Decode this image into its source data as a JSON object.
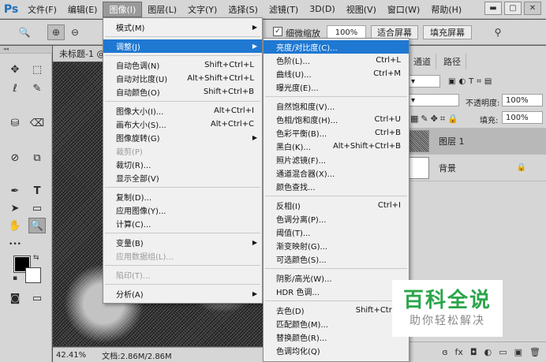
{
  "menubar": {
    "logo": "Ps",
    "items": [
      "文件(F)",
      "编辑(E)",
      "图像(I)",
      "图层(L)",
      "文字(Y)",
      "选择(S)",
      "滤镜(T)",
      "3D(D)",
      "视图(V)",
      "窗口(W)",
      "帮助(H)"
    ],
    "window_controls": [
      "▬",
      "▢",
      "✕"
    ]
  },
  "options": {
    "tool_icon": "🔍",
    "zoom_in": "⊕",
    "zoom_out": "⊖",
    "scrubby_label": "细微缩放",
    "zoom_value": "100%",
    "fit_screen": "适合屏幕",
    "fill_screen": "填充屏幕",
    "search_icon": "⚲"
  },
  "tools": {
    "grip": "◂◂",
    "icons": [
      "✥",
      "⬚",
      "ℓ",
      "✎",
      "⛁",
      "⌫",
      "⊘",
      "⧉",
      "✒",
      "T",
      "➤",
      "▭",
      "✋",
      "🔍",
      "•••"
    ],
    "fg_bg_swap": "⇆",
    "default_colors": "▪",
    "quick_mask": "◙",
    "screen_mode": "▭"
  },
  "document": {
    "tab_title": "未标题-1 @",
    "zoom": "42.41%",
    "doc_info": "文档:2.86M/2.86M"
  },
  "panels": {
    "tabs": [
      "通道",
      "路径"
    ],
    "opacity_label": "不透明度:",
    "opacity_value": "100%",
    "fill_label": "填充:",
    "fill_value": "100%",
    "layers": [
      {
        "name": "图层 1",
        "selected": true
      },
      {
        "name": "背景",
        "selected": false,
        "lock": "🔒"
      }
    ],
    "footer_icons": [
      "ɞ",
      "fx",
      "◘",
      "◐",
      "▭",
      "▣",
      "🗑"
    ]
  },
  "image_menu": {
    "items": [
      {
        "label": "模式(M)",
        "shortcut": "",
        "arrow": true,
        "disabled": false,
        "highlight": false,
        "sep_after": true
      },
      {
        "label": "调整(J)",
        "shortcut": "",
        "arrow": true,
        "disabled": false,
        "highlight": true,
        "sep_after": true
      },
      {
        "label": "自动色调(N)",
        "shortcut": "Shift+Ctrl+L",
        "arrow": false,
        "disabled": false,
        "highlight": false,
        "sep_after": false
      },
      {
        "label": "自动对比度(U)",
        "shortcut": "Alt+Shift+Ctrl+L",
        "arrow": false,
        "disabled": false,
        "highlight": false,
        "sep_after": false
      },
      {
        "label": "自动颜色(O)",
        "shortcut": "Shift+Ctrl+B",
        "arrow": false,
        "disabled": false,
        "highlight": false,
        "sep_after": true
      },
      {
        "label": "图像大小(I)...",
        "shortcut": "Alt+Ctrl+I",
        "arrow": false,
        "disabled": false,
        "highlight": false,
        "sep_after": false
      },
      {
        "label": "画布大小(S)...",
        "shortcut": "Alt+Ctrl+C",
        "arrow": false,
        "disabled": false,
        "highlight": false,
        "sep_after": false
      },
      {
        "label": "图像旋转(G)",
        "shortcut": "",
        "arrow": true,
        "disabled": false,
        "highlight": false,
        "sep_after": false
      },
      {
        "label": "裁剪(P)",
        "shortcut": "",
        "arrow": false,
        "disabled": true,
        "highlight": false,
        "sep_after": false
      },
      {
        "label": "裁切(R)...",
        "shortcut": "",
        "arrow": false,
        "disabled": false,
        "highlight": false,
        "sep_after": false
      },
      {
        "label": "显示全部(V)",
        "shortcut": "",
        "arrow": false,
        "disabled": false,
        "highlight": false,
        "sep_after": true
      },
      {
        "label": "复制(D)...",
        "shortcut": "",
        "arrow": false,
        "disabled": false,
        "highlight": false,
        "sep_after": false
      },
      {
        "label": "应用图像(Y)...",
        "shortcut": "",
        "arrow": false,
        "disabled": false,
        "highlight": false,
        "sep_after": false
      },
      {
        "label": "计算(C)...",
        "shortcut": "",
        "arrow": false,
        "disabled": false,
        "highlight": false,
        "sep_after": true
      },
      {
        "label": "变量(B)",
        "shortcut": "",
        "arrow": true,
        "disabled": false,
        "highlight": false,
        "sep_after": false
      },
      {
        "label": "应用数据组(L)...",
        "shortcut": "",
        "arrow": false,
        "disabled": true,
        "highlight": false,
        "sep_after": true
      },
      {
        "label": "陷印(T)...",
        "shortcut": "",
        "arrow": false,
        "disabled": true,
        "highlight": false,
        "sep_after": true
      },
      {
        "label": "分析(A)",
        "shortcut": "",
        "arrow": true,
        "disabled": false,
        "highlight": false,
        "sep_after": false
      }
    ]
  },
  "adjust_menu": {
    "items": [
      {
        "label": "亮度/对比度(C)...",
        "shortcut": "",
        "highlight": true,
        "sep_after": false
      },
      {
        "label": "色阶(L)...",
        "shortcut": "Ctrl+L",
        "highlight": false,
        "sep_after": false
      },
      {
        "label": "曲线(U)...",
        "shortcut": "Ctrl+M",
        "highlight": false,
        "sep_after": false
      },
      {
        "label": "曝光度(E)...",
        "shortcut": "",
        "highlight": false,
        "sep_after": true
      },
      {
        "label": "自然饱和度(V)...",
        "shortcut": "",
        "highlight": false,
        "sep_after": false
      },
      {
        "label": "色相/饱和度(H)...",
        "shortcut": "Ctrl+U",
        "highlight": false,
        "sep_after": false
      },
      {
        "label": "色彩平衡(B)...",
        "shortcut": "Ctrl+B",
        "highlight": false,
        "sep_after": false
      },
      {
        "label": "黑白(K)...",
        "shortcut": "Alt+Shift+Ctrl+B",
        "highlight": false,
        "sep_after": false
      },
      {
        "label": "照片滤镜(F)...",
        "shortcut": "",
        "highlight": false,
        "sep_after": false
      },
      {
        "label": "通道混合器(X)...",
        "shortcut": "",
        "highlight": false,
        "sep_after": false
      },
      {
        "label": "颜色查找...",
        "shortcut": "",
        "highlight": false,
        "sep_after": true
      },
      {
        "label": "反相(I)",
        "shortcut": "Ctrl+I",
        "highlight": false,
        "sep_after": false
      },
      {
        "label": "色调分离(P)...",
        "shortcut": "",
        "highlight": false,
        "sep_after": false
      },
      {
        "label": "阈值(T)...",
        "shortcut": "",
        "highlight": false,
        "sep_after": false
      },
      {
        "label": "渐变映射(G)...",
        "shortcut": "",
        "highlight": false,
        "sep_after": false
      },
      {
        "label": "可选颜色(S)...",
        "shortcut": "",
        "highlight": false,
        "sep_after": true
      },
      {
        "label": "阴影/高光(W)...",
        "shortcut": "",
        "highlight": false,
        "sep_after": false
      },
      {
        "label": "HDR 色调...",
        "shortcut": "",
        "highlight": false,
        "sep_after": true
      },
      {
        "label": "去色(D)",
        "shortcut": "Shift+Ctrl+",
        "highlight": false,
        "sep_after": false
      },
      {
        "label": "匹配颜色(M)...",
        "shortcut": "",
        "highlight": false,
        "sep_after": false
      },
      {
        "label": "替换颜色(R)...",
        "shortcut": "",
        "highlight": false,
        "sep_after": false
      },
      {
        "label": "色调均化(Q)",
        "shortcut": "",
        "highlight": false,
        "sep_after": false
      }
    ]
  },
  "watermark": {
    "title": "百科全说",
    "subtitle": "助你轻松解决"
  }
}
